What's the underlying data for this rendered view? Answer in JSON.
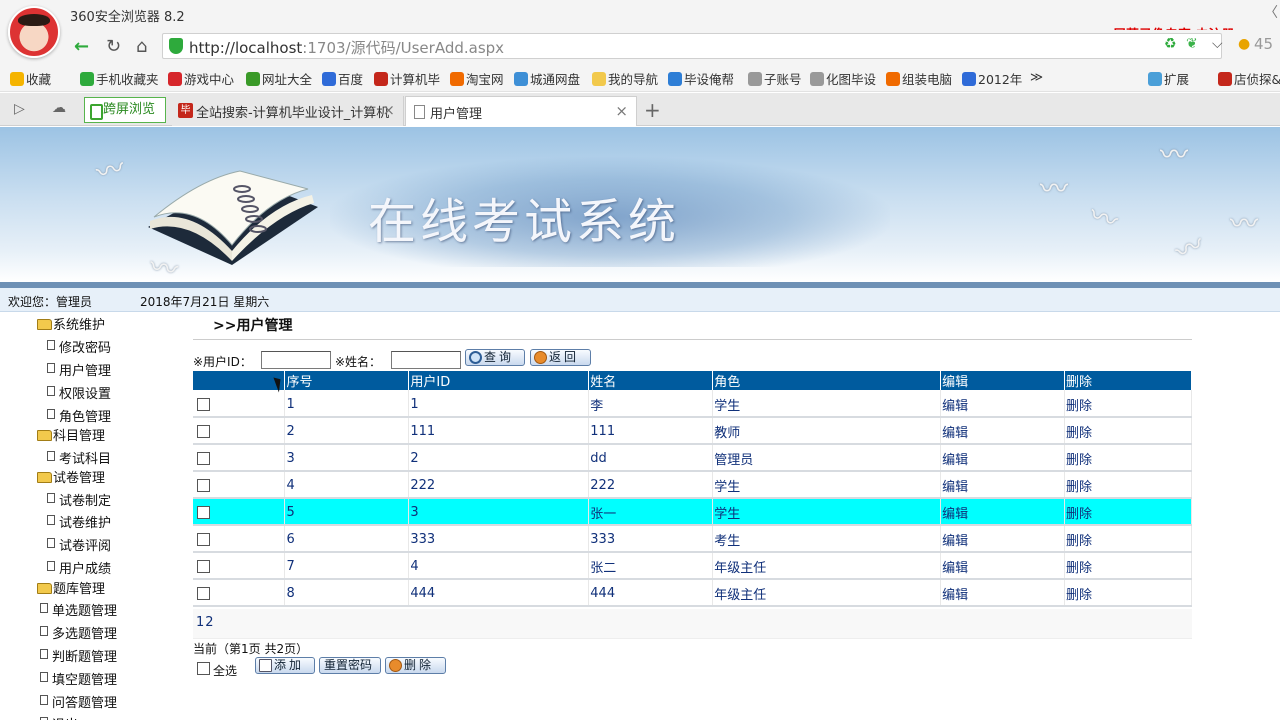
{
  "browser": {
    "name": "360安全浏览器 8.2",
    "recorder_label": "屏幕录像专家 未注册",
    "window_ctrl": "〈",
    "url_host": "http://localhost",
    "url_rest": ":1703/源代码/UserAdd.aspx",
    "url_right_text": "45"
  },
  "bookmarks": [
    {
      "label": "收藏",
      "icon": "star-icon",
      "color": "#f5b400"
    },
    {
      "label": "手机收藏夹",
      "icon": "phone-icon",
      "color": "#2eaa3c"
    },
    {
      "label": "游戏中心",
      "icon": "game-icon",
      "color": "#d6262b"
    },
    {
      "label": "网址大全",
      "icon": "globe-icon",
      "color": "#3a9a28"
    },
    {
      "label": "百度",
      "icon": "paw-icon",
      "color": "#2f6bd8"
    },
    {
      "label": "计算机毕",
      "icon": "bi-icon",
      "color": "#c4271b"
    },
    {
      "label": "淘宝网",
      "icon": "taobao-icon",
      "color": "#f06a00"
    },
    {
      "label": "城通网盘",
      "icon": "ct-icon",
      "color": "#3e8fd6"
    },
    {
      "label": "我的导航",
      "icon": "folder-icon",
      "color": "#f2c94c"
    },
    {
      "label": "毕设俺帮",
      "icon": "tv-icon",
      "color": "#2e7ed6"
    },
    {
      "label": "子账号",
      "icon": "page-icon",
      "color": "#999999"
    },
    {
      "label": "化图毕设",
      "icon": "page-icon",
      "color": "#999999"
    },
    {
      "label": "组装电脑",
      "icon": "taobao-icon",
      "color": "#f06a00"
    },
    {
      "label": "2012年",
      "icon": "paw-icon",
      "color": "#2f6bd8"
    },
    {
      "label": "扩展",
      "icon": "apps-icon",
      "color": "#4a9fd8"
    },
    {
      "label": "店侦探&",
      "icon": "shop-icon",
      "color": "#c4271b"
    }
  ],
  "tabs": {
    "kuaping": "跨屏浏览",
    "tab1": "全站搜索-计算机毕业设计_计算机",
    "tab2": "用户管理",
    "close": "×",
    "new": "+"
  },
  "banner": {
    "title": "在线考试系统"
  },
  "welcome": {
    "text": "欢迎您：管理员",
    "date": "2018年7月21日 星期六"
  },
  "sidebar": [
    {
      "label": "系统维护",
      "type": "folder"
    },
    {
      "label": "修改密码",
      "type": "page"
    },
    {
      "label": "用户管理",
      "type": "page"
    },
    {
      "label": "权限设置",
      "type": "page"
    },
    {
      "label": "角色管理",
      "type": "page"
    },
    {
      "label": "科目管理",
      "type": "folder"
    },
    {
      "label": "考试科目",
      "type": "page"
    },
    {
      "label": "试卷管理",
      "type": "folder"
    },
    {
      "label": "试卷制定",
      "type": "page"
    },
    {
      "label": "试卷维护",
      "type": "page"
    },
    {
      "label": "试卷评阅",
      "type": "page"
    },
    {
      "label": "用户成绩",
      "type": "page"
    },
    {
      "label": "题库管理",
      "type": "folder"
    },
    {
      "label": "单选题管理",
      "type": "page"
    },
    {
      "label": "多选题管理",
      "type": "page"
    },
    {
      "label": "判断题管理",
      "type": "page"
    },
    {
      "label": "填空题管理",
      "type": "page"
    },
    {
      "label": "问答题管理",
      "type": "page"
    },
    {
      "label": "退出",
      "type": "page"
    }
  ],
  "main": {
    "heading": ">>用户管理",
    "search": {
      "userid_label": "※用户ID：",
      "userid_value": "",
      "name_label": "※姓名：",
      "name_value": "",
      "query_button": "查询",
      "back_button": "返回"
    },
    "table": {
      "columns": [
        "",
        "序号",
        "用户ID",
        "姓名",
        "角色",
        "编辑",
        "删除"
      ],
      "rows": [
        [
          "1",
          "1",
          "李",
          "学生",
          "编辑",
          "删除"
        ],
        [
          "2",
          "111",
          "111",
          "教师",
          "编辑",
          "删除"
        ],
        [
          "3",
          "2",
          "dd",
          "管理员",
          "编辑",
          "删除"
        ],
        [
          "4",
          "222",
          "222",
          "学生",
          "编辑",
          "删除"
        ],
        [
          "5",
          "3",
          "张一",
          "学生",
          "编辑",
          "删除"
        ],
        [
          "6",
          "333",
          "333",
          "考生",
          "编辑",
          "删除"
        ],
        [
          "7",
          "4",
          "张二",
          "年级主任",
          "编辑",
          "删除"
        ],
        [
          "8",
          "444",
          "444",
          "年级主任",
          "编辑",
          "删除"
        ]
      ],
      "selected_row": 4,
      "selected_color": "#00ffff",
      "header_color": "#005b9e"
    },
    "pager": "12",
    "page_info": "当前（第1页 共2页）",
    "select_all": "全选",
    "add_button": "添加",
    "reset_pwd_button": "重置密码",
    "delete_button": "删除"
  }
}
